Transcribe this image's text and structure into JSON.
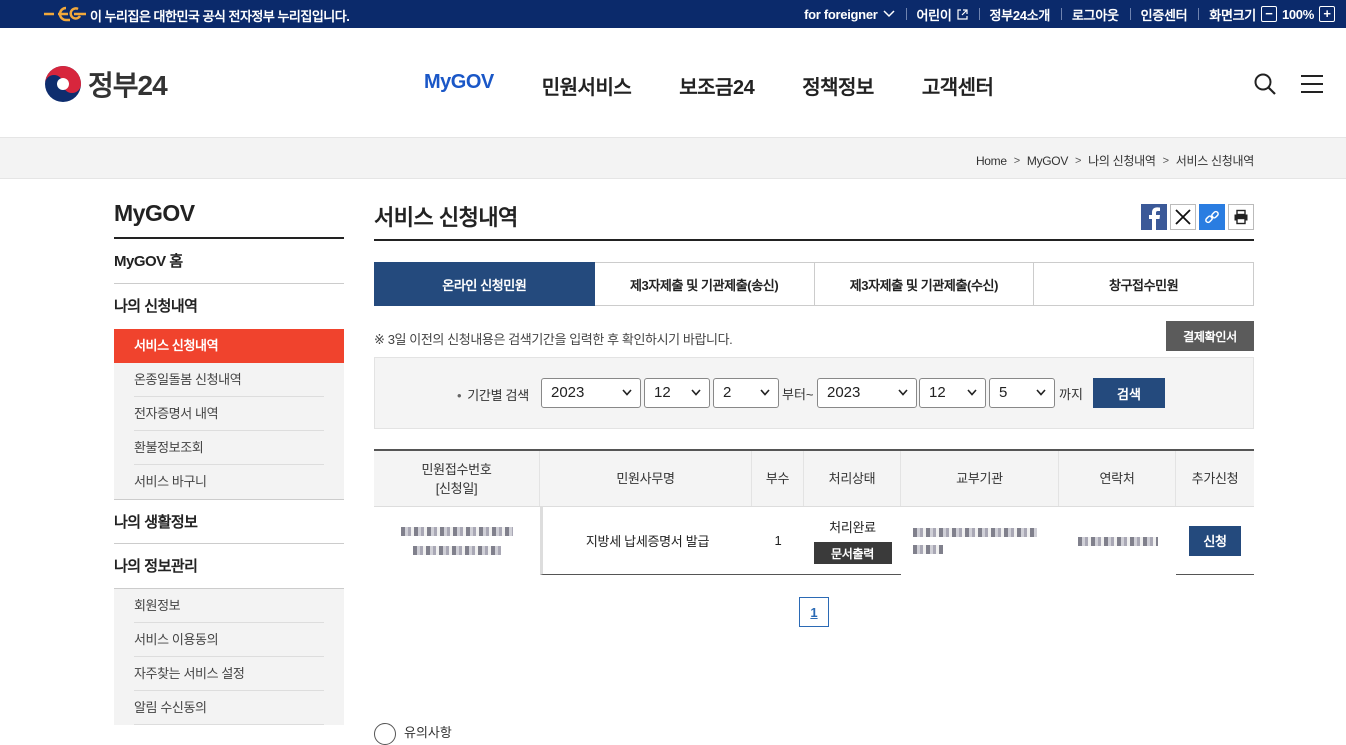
{
  "gov_bar": {
    "notice": "이 누리집은 대한민국 공식 전자정부 누리집입니다.",
    "util": [
      "for foreigner",
      "어린이",
      "정부24소개",
      "로그아웃",
      "인증센터",
      "화면크기"
    ],
    "zoom": "100%",
    "zoom_minus": "−",
    "zoom_plus": "+"
  },
  "header": {
    "site_name": "정부24",
    "nav": [
      "MyGOV",
      "민원서비스",
      "보조금24",
      "정책정보",
      "고객센터"
    ]
  },
  "breadcrumb": [
    "Home",
    "MyGOV",
    "나의 신청내역",
    "서비스 신청내역"
  ],
  "lnb": {
    "title": "MyGOV",
    "home": "MyGOV 홈",
    "apply_history": "나의 신청내역",
    "apply_sub": [
      "서비스 신청내역",
      "온종일돌봄 신청내역",
      "전자증명서 내역",
      "환불정보조회",
      "서비스 바구니"
    ],
    "life_info": "나의 생활정보",
    "info_manage": "나의 정보관리",
    "manage_sub": [
      "회원정보",
      "서비스 이용동의",
      "자주찾는 서비스 설정",
      "알림 수신동의"
    ]
  },
  "content": {
    "title": "서비스 신청내역",
    "tabs": [
      "온라인 신청민원",
      "제3자제출 및 기관제출(송신)",
      "제3자제출 및 기관제출(수신)",
      "창구접수민원"
    ],
    "notice": "※ 3일 이전의 신청내용은 검색기간을 입력한 후 확인하시기 바랍니다.",
    "receipt_button": "결제확인서",
    "search": {
      "label": "기간별 검색",
      "from_year": "2023",
      "from_month": "12",
      "from_day": "2",
      "from_suffix": "부터~",
      "to_year": "2023",
      "to_month": "12",
      "to_day": "5",
      "to_suffix": "까지",
      "button": "검색"
    },
    "table": {
      "headers": [
        "민원접수번호\n[신청일]",
        "민원사무명",
        "부수",
        "처리상태",
        "교부기관",
        "연락처",
        "추가신청"
      ],
      "rows": [
        {
          "service_name": "지방세 납세증명서 발급",
          "copies": "1",
          "status": "처리완료",
          "print_button": "문서출력",
          "apply_button": "신청"
        }
      ]
    },
    "pagination": [
      "1"
    ]
  },
  "bottom_peek": "유의사항",
  "colors": {
    "gov_bar": "#0b2a6b",
    "accent_blue": "#1a57c7",
    "tab_active": "#244a7d",
    "lnb_active": "#f0432d"
  }
}
